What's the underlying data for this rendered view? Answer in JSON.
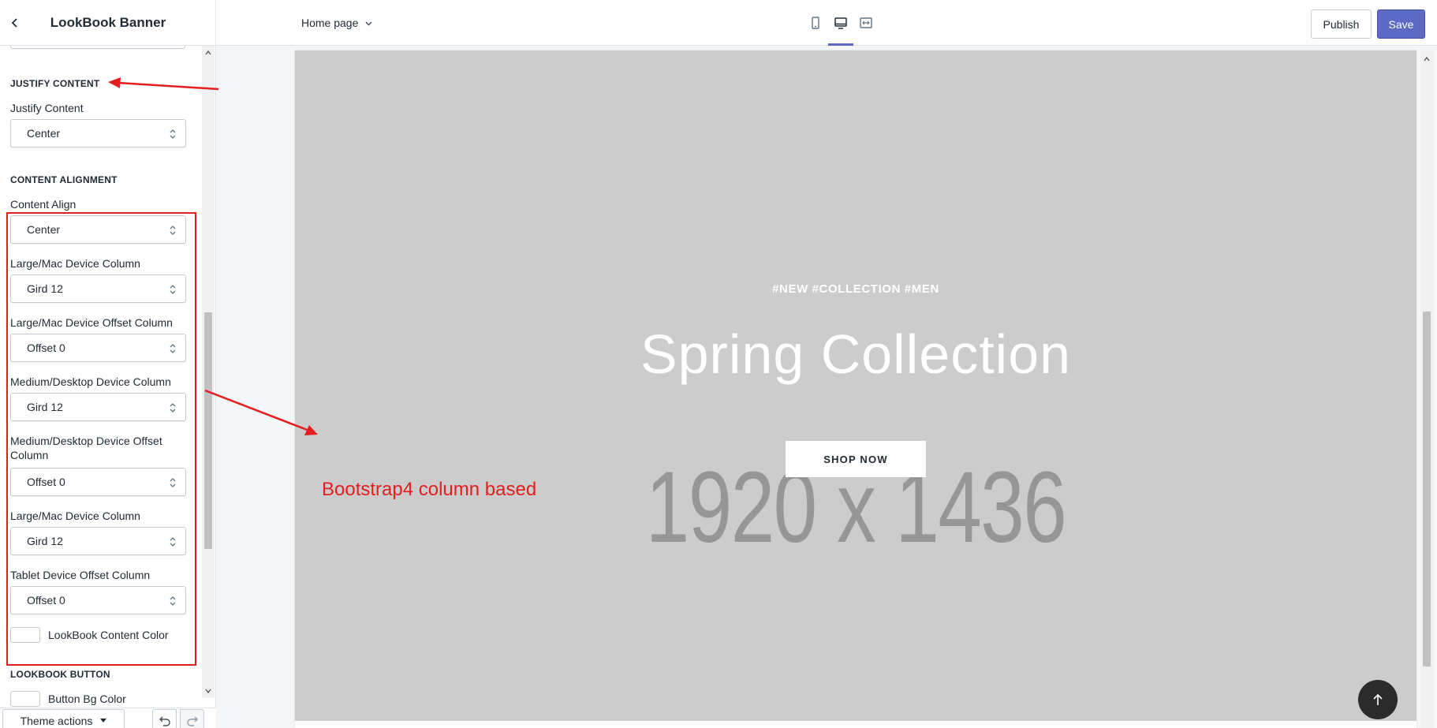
{
  "header": {
    "title": "LookBook Banner",
    "page_selector": "Home page",
    "publish_label": "Publish",
    "save_label": "Save",
    "active_view": "desktop",
    "accent_color": "#5c6ac4"
  },
  "sidebar": {
    "justify_section": {
      "heading": "JUSTIFY CONTENT",
      "label": "Justify Content",
      "value": "Center"
    },
    "alignment_section": {
      "heading": "CONTENT ALIGNMENT",
      "fields": [
        {
          "label": "Content Align",
          "value": "Center"
        },
        {
          "label": "Large/Mac Device Column",
          "value": "Gird 12"
        },
        {
          "label": "Large/Mac Device Offset Column",
          "value": "Offset 0"
        },
        {
          "label": "Medium/Desktop Device Column",
          "value": "Gird 12"
        },
        {
          "label": "Medium/Desktop Device Offset Column",
          "value": "Offset 0"
        },
        {
          "label": "Large/Mac Device Column",
          "value": "Gird 12"
        },
        {
          "label": "Tablet Device Offset Column",
          "value": "Offset 0"
        }
      ]
    },
    "content_color_label": "LookBook Content Color",
    "button_section": {
      "heading": "LOOKBOOK BUTTON",
      "bg_color_label": "Button Bg Color"
    },
    "footer": {
      "theme_actions_label": "Theme actions"
    }
  },
  "preview": {
    "tags": "#NEW #COLLECTION #MEN",
    "title": "Spring Collection",
    "placeholder_dims": "1920 x 1436",
    "button_label": "SHOP NOW",
    "banner_bg": "#cccccc"
  },
  "annotation": {
    "text": "Bootstrap4 column based",
    "color": "#e41e1e"
  }
}
